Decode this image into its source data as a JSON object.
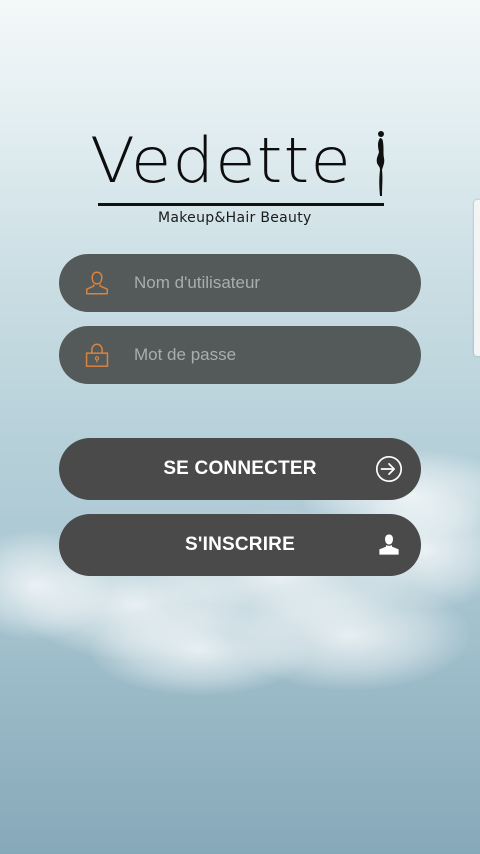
{
  "app": {
    "logo_text": "Vedette",
    "tagline": "Makeup&Hair Beauty"
  },
  "login_form": {
    "username": {
      "placeholder": "Nom d'utilisateur",
      "value": "",
      "icon": "user-outline-icon"
    },
    "password": {
      "placeholder": "Mot de passe",
      "value": "",
      "icon": "lock-icon"
    },
    "login_button": {
      "label": "SE CONNECTER",
      "icon": "sign-in-icon"
    },
    "register_button": {
      "label": "S'INSCRIRE",
      "icon": "user-solid-icon"
    }
  },
  "colors": {
    "field_background": "#545a5a",
    "button_background": "#4a4a4b",
    "icon_accent": "#d9833f",
    "button_text": "#ffffff"
  }
}
